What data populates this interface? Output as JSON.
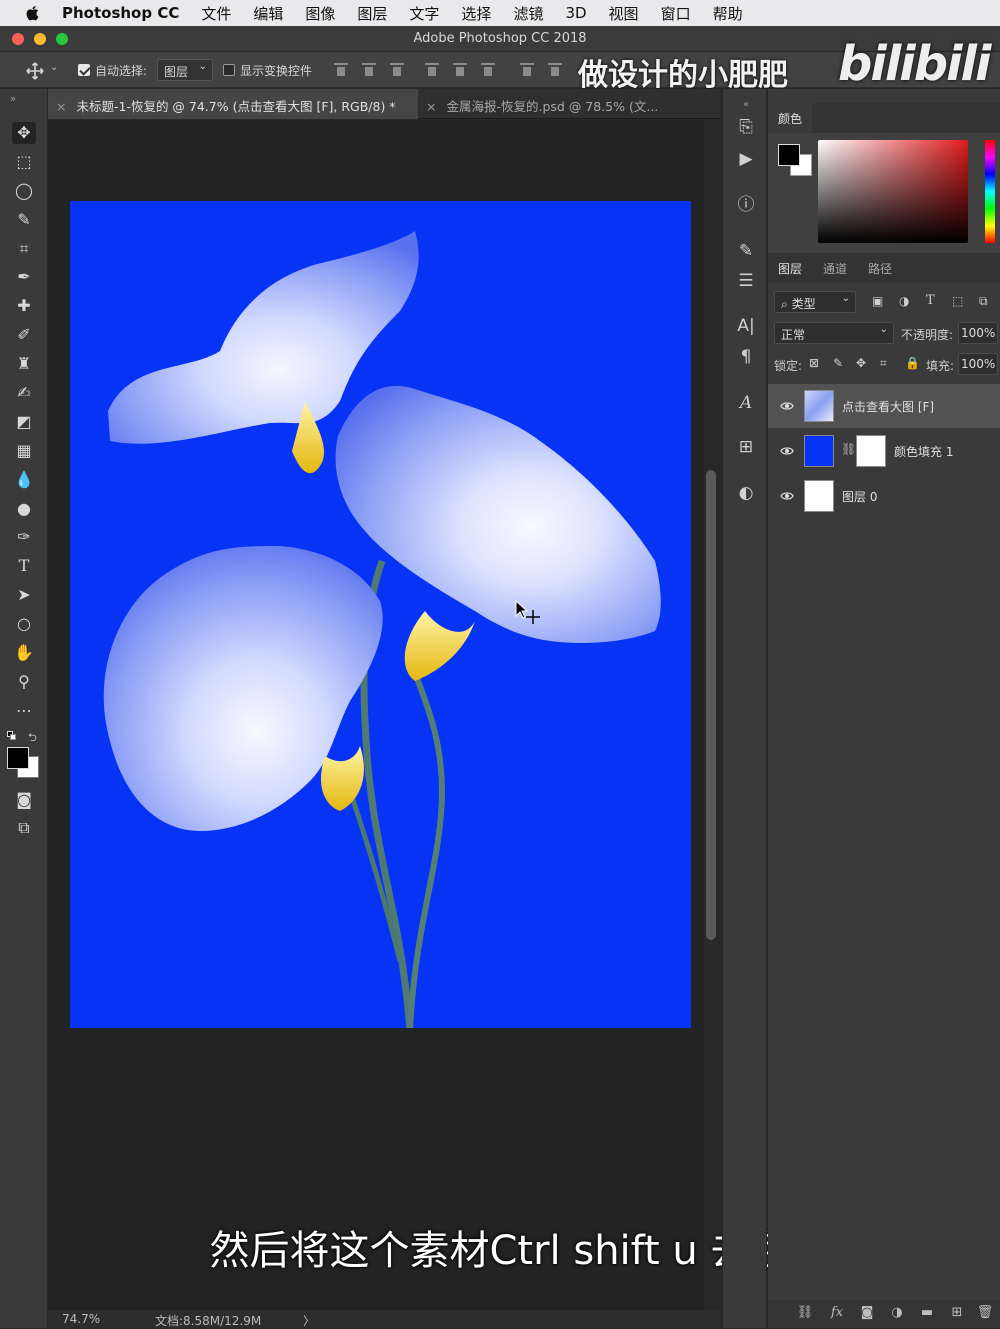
{
  "menubar": {
    "app_name": "Photoshop CC",
    "items": [
      "文件",
      "编辑",
      "图像",
      "图层",
      "文字",
      "选择",
      "滤镜",
      "3D",
      "视图",
      "窗口",
      "帮助"
    ]
  },
  "window": {
    "title": "Adobe Photoshop CC 2018"
  },
  "options": {
    "auto_select_label": "自动选择:",
    "auto_select_value": "图层",
    "show_transform_label": "显示变换控件"
  },
  "overlay": {
    "watermark": "做设计的小肥肥",
    "logo": "bilibili",
    "subtitle": "然后将这个素材Ctrl shift u 去色"
  },
  "tabs": [
    {
      "label": "未标题-1-恢复的 @ 74.7% (点击查看大图 [F], RGB/8) *",
      "active": true
    },
    {
      "label": "金属海报-恢复的.psd @ 78.5% (文...",
      "active": false
    }
  ],
  "status": {
    "zoom": "74.7%",
    "doc": "文档:8.58M/12.9M",
    "arrow": "〉"
  },
  "panels": {
    "color_tab": "颜色",
    "layer_tabs": [
      "图层",
      "通道",
      "路径"
    ],
    "filter_kind": "类型",
    "blend_mode": "正常",
    "opacity_label": "不透明度:",
    "opacity_value": "100%",
    "lock_label": "锁定:",
    "fill_label": "填充:",
    "fill_value": "100%"
  },
  "layers": [
    {
      "name": "点击查看大图 [F]",
      "selected": true
    },
    {
      "name": "颜色填充 1",
      "selected": false
    },
    {
      "name": "图层 0",
      "selected": false
    }
  ],
  "colors": {
    "canvas_bg": "#0633f4",
    "foreground": "#000000",
    "background": "#ffffff"
  }
}
